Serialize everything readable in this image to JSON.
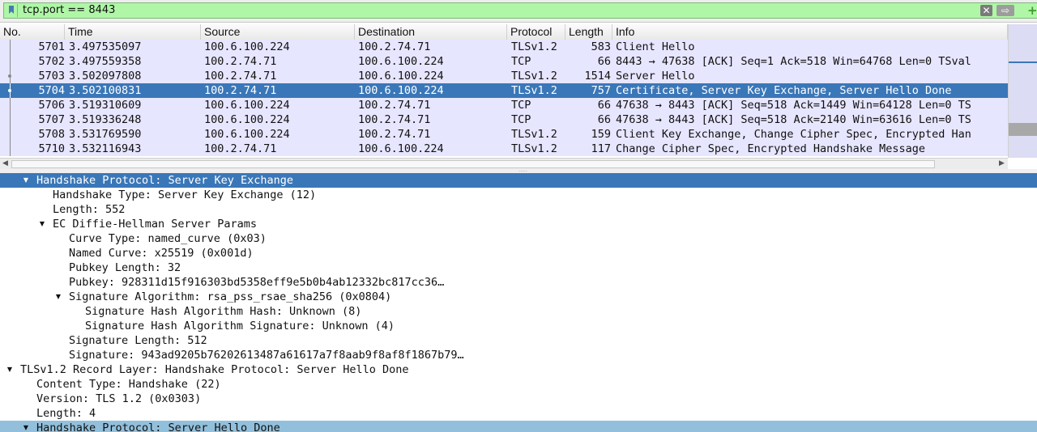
{
  "filter": {
    "value": "tcp.port == 8443",
    "bookmark_icon": "bookmark-icon",
    "clear_icon": "clear-icon",
    "clear_glyph": "✕",
    "apply_icon": "apply-arrow-icon",
    "apply_glyph": "⇨",
    "add_icon": "add-plus-icon",
    "add_glyph": "+"
  },
  "packet_list": {
    "columns": [
      "No.",
      "Time",
      "Source",
      "Destination",
      "Protocol",
      "Length",
      "Info"
    ],
    "rows": [
      {
        "no": "5701",
        "time": "3.497535097",
        "src": "100.6.100.224",
        "dst": "100.2.74.71",
        "proto": "TLSv1.2",
        "len": "583",
        "info": "Client Hello"
      },
      {
        "no": "5702",
        "time": "3.497559358",
        "src": "100.2.74.71",
        "dst": "100.6.100.224",
        "proto": "TCP",
        "len": "66",
        "info": "8443 → 47638 [ACK] Seq=1 Ack=518 Win=64768 Len=0 TSval"
      },
      {
        "no": "5703",
        "time": "3.502097808",
        "src": "100.2.74.71",
        "dst": "100.6.100.224",
        "proto": "TLSv1.2",
        "len": "1514",
        "info": "Server Hello"
      },
      {
        "no": "5704",
        "time": "3.502100831",
        "src": "100.2.74.71",
        "dst": "100.6.100.224",
        "proto": "TLSv1.2",
        "len": "757",
        "info": "Certificate, Server Key Exchange, Server Hello Done"
      },
      {
        "no": "5706",
        "time": "3.519310609",
        "src": "100.6.100.224",
        "dst": "100.2.74.71",
        "proto": "TCP",
        "len": "66",
        "info": "47638 → 8443 [ACK] Seq=518 Ack=1449 Win=64128 Len=0 TS"
      },
      {
        "no": "5707",
        "time": "3.519336248",
        "src": "100.6.100.224",
        "dst": "100.2.74.71",
        "proto": "TCP",
        "len": "66",
        "info": "47638 → 8443 [ACK] Seq=518 Ack=2140 Win=63616 Len=0 TS"
      },
      {
        "no": "5708",
        "time": "3.531769590",
        "src": "100.6.100.224",
        "dst": "100.2.74.71",
        "proto": "TLSv1.2",
        "len": "159",
        "info": "Client Key Exchange, Change Cipher Spec, Encrypted Han"
      },
      {
        "no": "5710",
        "time": "3.532116943",
        "src": "100.2.74.71",
        "dst": "100.6.100.224",
        "proto": "TLSv1.2",
        "len": "117",
        "info": "Change Cipher Spec, Encrypted Handshake Message"
      }
    ],
    "selected_row": 3,
    "colors": {
      "row_bg": "#e7e6ff",
      "selected_bg": "#3a77b8",
      "related_bg": "#92c0dc"
    }
  },
  "details": {
    "rows": [
      {
        "text": "Handshake Protocol: Server Key Exchange",
        "state": "expanded",
        "style": "selected"
      },
      {
        "text": "Handshake Type: Server Key Exchange (12)",
        "state": "leaf"
      },
      {
        "text": "Length: 552",
        "state": "leaf"
      },
      {
        "text": "EC Diffie-Hellman Server Params",
        "state": "expanded"
      },
      {
        "text": "Curve Type: named_curve (0x03)",
        "state": "leaf"
      },
      {
        "text": "Named Curve: x25519 (0x001d)",
        "state": "leaf"
      },
      {
        "text": "Pubkey Length: 32",
        "state": "leaf"
      },
      {
        "text": "Pubkey: 928311d15f916303bd5358eff9e5b0b4ab12332bc817cc36…",
        "state": "leaf"
      },
      {
        "text": "Signature Algorithm: rsa_pss_rsae_sha256 (0x0804)",
        "state": "expanded"
      },
      {
        "text": "Signature Hash Algorithm Hash: Unknown (8)",
        "state": "leaf"
      },
      {
        "text": "Signature Hash Algorithm Signature: Unknown (4)",
        "state": "leaf"
      },
      {
        "text": "Signature Length: 512",
        "state": "leaf"
      },
      {
        "text": "Signature: 943ad9205b76202613487a61617a7f8aab9f8af8f1867b79…",
        "state": "leaf"
      },
      {
        "text": "TLSv1.2 Record Layer: Handshake Protocol: Server Hello Done",
        "state": "expanded"
      },
      {
        "text": "Content Type: Handshake (22)",
        "state": "leaf"
      },
      {
        "text": "Version: TLS 1.2 (0x0303)",
        "state": "leaf"
      },
      {
        "text": "Length: 4",
        "state": "leaf"
      },
      {
        "text": "Handshake Protocol: Server Hello Done",
        "state": "expanded",
        "style": "related"
      }
    ]
  }
}
